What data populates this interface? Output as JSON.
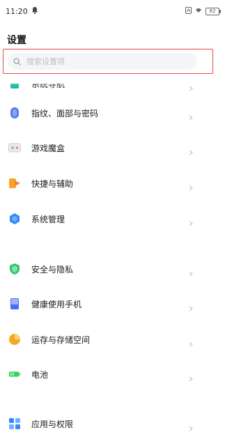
{
  "status": {
    "time": "11:20",
    "battery_level": "82"
  },
  "page": {
    "title": "设置"
  },
  "search": {
    "placeholder": "搜索设置项"
  },
  "items": [
    {
      "label": "系统导航",
      "icon": "system-navigation-icon",
      "color": "#24b8a3"
    },
    {
      "label": "指纹、面部与密码",
      "icon": "fingerprint-icon",
      "color": "#5b7cf0"
    },
    {
      "label": "游戏魔盒",
      "icon": "game-box-icon",
      "color": "#e9566b"
    },
    {
      "label": "快捷与辅助",
      "icon": "shortcut-icon",
      "color": "#f5a623"
    },
    {
      "label": "系统管理",
      "icon": "system-management-icon",
      "color": "#2f8cf5"
    },
    {
      "label": "安全与隐私",
      "icon": "shield-icon",
      "color": "#2cc46b"
    },
    {
      "label": "健康使用手机",
      "icon": "phone-health-icon",
      "color": "#4a6cf0"
    },
    {
      "label": "运存与存储空间",
      "icon": "storage-pie-icon",
      "color": "#f5a623"
    },
    {
      "label": "电池",
      "icon": "battery-icon",
      "color": "#3ccf5a"
    },
    {
      "label": "应用与权限",
      "icon": "apps-icon",
      "color": "#2f8cf5"
    }
  ]
}
